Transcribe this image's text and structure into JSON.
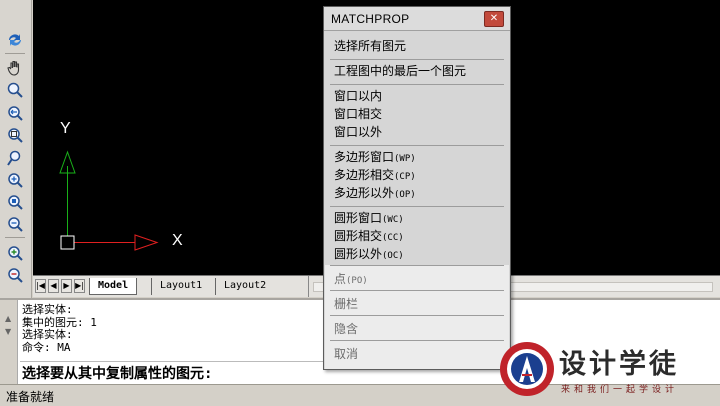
{
  "canvas": {
    "axis_y_label": "Y",
    "axis_x_label": "X",
    "colors": {
      "background": "#000000",
      "x_axis": "#e02020",
      "y_axis": "#19b019",
      "origin_box": "#ffffff"
    }
  },
  "toolbar": {
    "tools": [
      "regen-icon",
      "pan-icon",
      "zoom-realtime-icon",
      "zoom-previous-icon",
      "zoom-window-icon",
      "zoom-dynamic-icon",
      "zoom-in-icon",
      "zoom-extents-icon",
      "zoom-object-icon",
      "zoom-in-plus-icon",
      "zoom-out-icon"
    ]
  },
  "tabs": {
    "nav": [
      "|◀",
      "◀",
      "▶",
      "▶|"
    ],
    "items": [
      {
        "label": "Model",
        "active": true
      },
      {
        "label": "Layout1",
        "active": false
      },
      {
        "label": "Layout2",
        "active": false
      }
    ]
  },
  "command": {
    "history": [
      "选择实体:",
      "集中的图元: 1",
      "选择实体:",
      "命令: MA"
    ],
    "prompt": "选择要从其中复制属性的图元:"
  },
  "status": {
    "text": "准备就绪"
  },
  "popup": {
    "title": "MATCHPROP",
    "close": "✕",
    "items": {
      "select_all": "选择所有图元",
      "last_in_drawing": "工程图中的最后一个图元",
      "window_inside": "窗口以内",
      "window_crossing": "窗口相交",
      "window_outside": "窗口以外",
      "polygon_window": "多边形窗口",
      "polygon_window_code": "(WP)",
      "polygon_crossing": "多边形相交",
      "polygon_crossing_code": "(CP)",
      "polygon_outside": "多边形以外",
      "polygon_outside_code": "(OP)",
      "circle_window": "圆形窗口",
      "circle_window_code": "(WC)",
      "circle_crossing": "圆形相交",
      "circle_crossing_code": "(CC)",
      "circle_outside": "圆形以外",
      "circle_outside_code": "(OC)",
      "point": "点",
      "point_code": "(PO)",
      "fence": "栅栏",
      "implied": "隐含",
      "cancel": "取消"
    }
  },
  "watermark": {
    "title": "设计学徒",
    "subtitle": "来和我们一起学设计",
    "colors": {
      "ring": "#c0232a",
      "inner": "#1b3f8f"
    }
  }
}
